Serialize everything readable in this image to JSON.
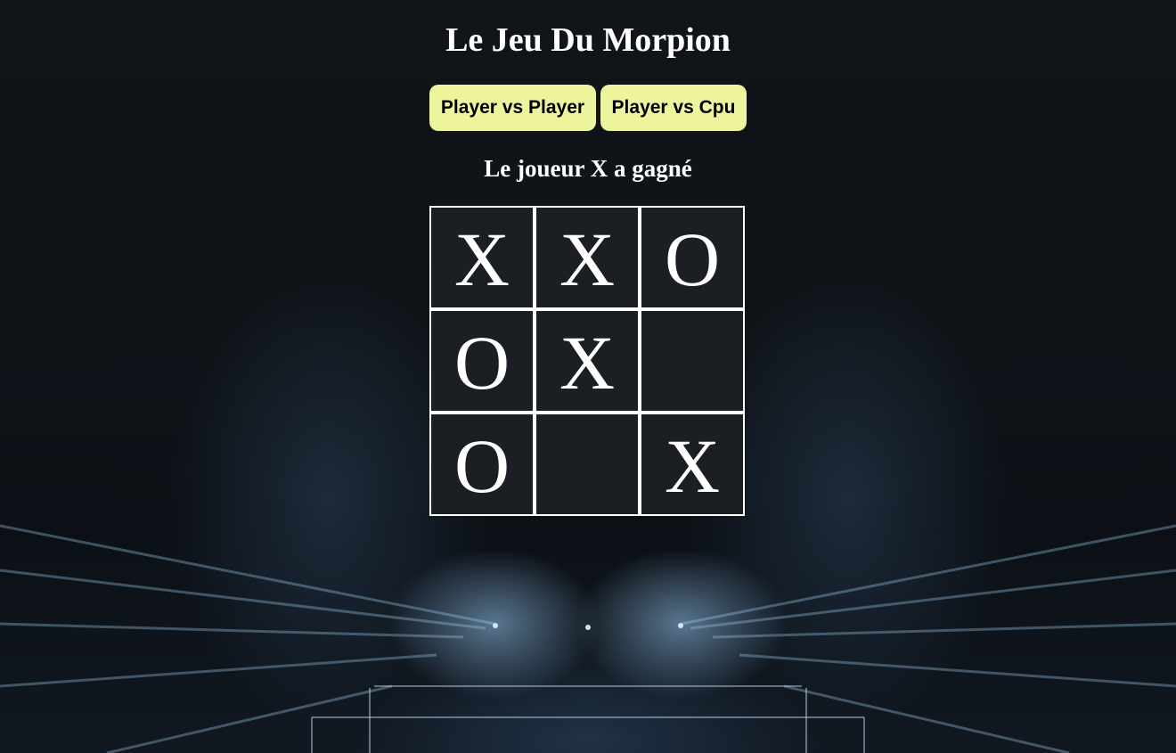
{
  "game": {
    "title": "Le Jeu Du Morpion",
    "modes": {
      "pvp_label": "Player vs Player",
      "cpu_label": "Player vs Cpu"
    },
    "status": "Le joueur X a gagné",
    "board": [
      [
        "X",
        "X",
        "O"
      ],
      [
        "O",
        "X",
        ""
      ],
      [
        "O",
        "",
        "X"
      ]
    ]
  },
  "colors": {
    "button_bg": "#eef39e",
    "text": "#ffffff",
    "grid_lines": "#ffffff",
    "cell_bg": "#0a0d12"
  }
}
